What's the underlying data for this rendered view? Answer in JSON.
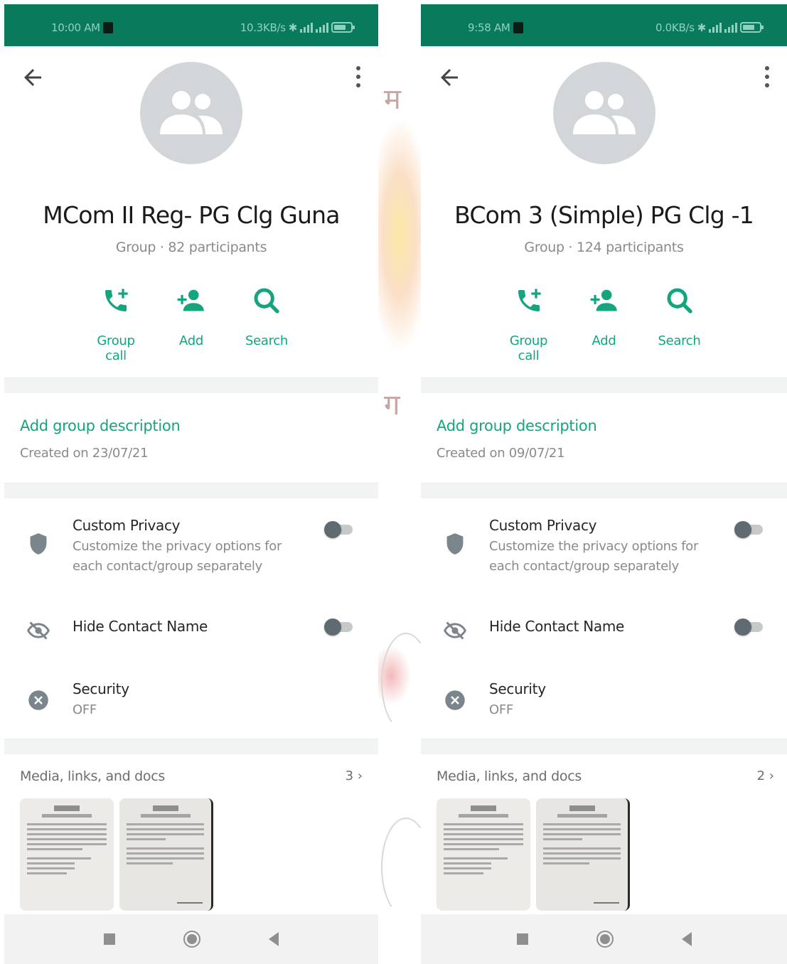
{
  "colors": {
    "status_bar": "#0a7a5c",
    "accent": "#14a57f",
    "avatar_bg": "#d3d6d8"
  },
  "screens": [
    {
      "status": {
        "time": "10:00 AM",
        "net_speed": "10.3KB/s"
      },
      "group": {
        "name": "MCom II Reg- PG Clg Guna",
        "subtitle": "Group · 82 participants"
      },
      "actions": {
        "call": "Group call",
        "add": "Add",
        "search": "Search"
      },
      "description": {
        "add_label": "Add group description",
        "created": "Created on 23/07/21"
      },
      "settings": {
        "privacy_title": "Custom Privacy",
        "privacy_desc": "Customize the privacy options for each contact/group separately",
        "privacy_enabled": false,
        "hide_name_title": "Hide Contact Name",
        "hide_name_enabled": false,
        "security_title": "Security",
        "security_status": "OFF"
      },
      "media": {
        "title": "Media, links, and docs",
        "count": "3 ›"
      }
    },
    {
      "status": {
        "time": "9:58 AM",
        "net_speed": "0.0KB/s"
      },
      "group": {
        "name": "BCom 3 (Simple) PG Clg -1",
        "subtitle": "Group · 124 participants"
      },
      "actions": {
        "call": "Group call",
        "add": "Add",
        "search": "Search"
      },
      "description": {
        "add_label": "Add group description",
        "created": "Created on 09/07/21"
      },
      "settings": {
        "privacy_title": "Custom Privacy",
        "privacy_desc": "Customize the privacy options for each contact/group separately",
        "privacy_enabled": false,
        "hide_name_title": "Hide Contact Name",
        "hide_name_enabled": false,
        "security_title": "Security",
        "security_status": "OFF"
      },
      "media": {
        "title": "Media, links, and docs",
        "count": "2 ›"
      }
    }
  ]
}
